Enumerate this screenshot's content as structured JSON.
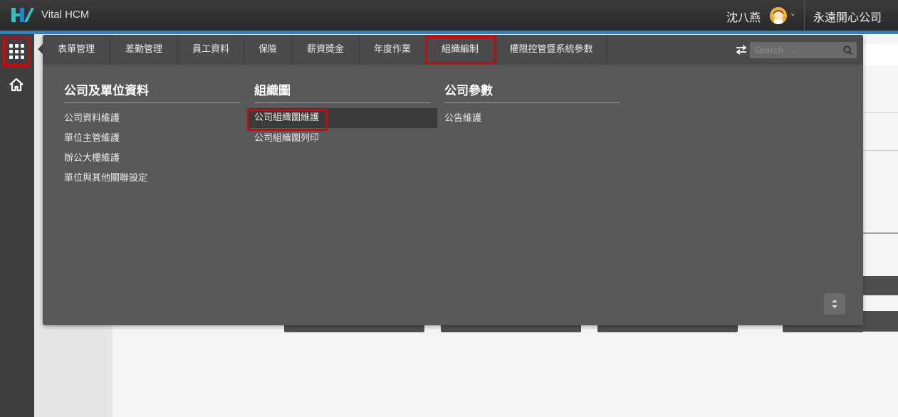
{
  "app": {
    "name": "Vital HCM",
    "brand_color": "#1d87d2"
  },
  "header": {
    "user_name": "沈八燕",
    "company": "永遠開心公司"
  },
  "menu": {
    "tabs": [
      {
        "label": "表單管理"
      },
      {
        "label": "差勤管理"
      },
      {
        "label": "員工資料"
      },
      {
        "label": "保險"
      },
      {
        "label": "薪資獎金"
      },
      {
        "label": "年度作業"
      },
      {
        "label": "組織編制",
        "active": true
      },
      {
        "label": "權限控管暨系統參數"
      }
    ],
    "search": {
      "placeholder": "Search ..."
    },
    "sections": [
      {
        "title": "公司及單位資料",
        "items": [
          "公司資料維護",
          "單位主管維護",
          "辦公大樓維護",
          "單位與其他關聯設定"
        ]
      },
      {
        "title": "組織圖",
        "items": [
          "公司組織圖維護",
          "公司組織圖列印"
        ],
        "highlighted_item": "公司組織圖維護"
      },
      {
        "title": "公司參數",
        "items": [
          "公告維護"
        ]
      }
    ]
  },
  "icons": {
    "apps": "grid-icon",
    "home": "home-icon",
    "swap": "swap-arrows-icon",
    "search": "search-icon",
    "scroll": "up-down-icon",
    "caret": "chevron-down-icon"
  }
}
